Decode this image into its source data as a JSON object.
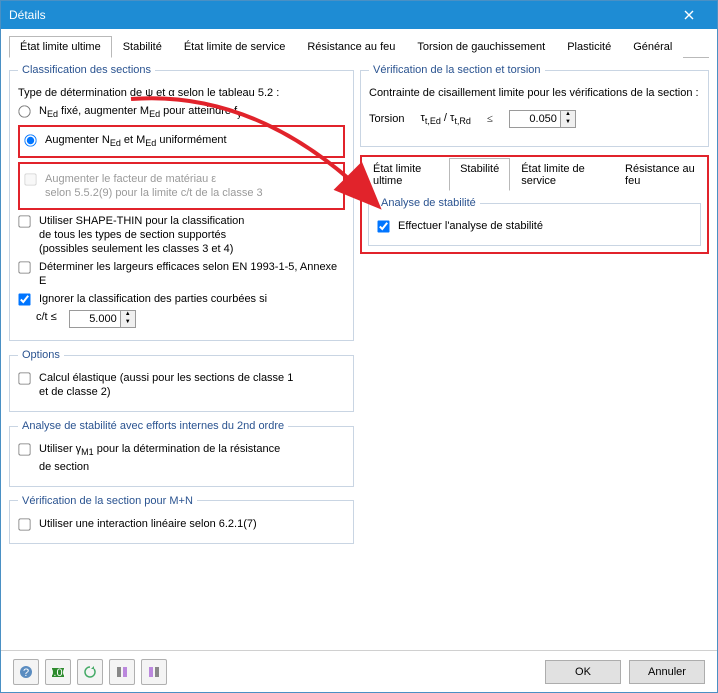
{
  "window": {
    "title": "Détails"
  },
  "tabs": {
    "t1": "État limite ultime",
    "t2": "Stabilité",
    "t3": "État limite de service",
    "t4": "Résistance au feu",
    "t5": "Torsion de gauchissement",
    "t6": "Plasticité",
    "t7": "Général"
  },
  "classif": {
    "legend": "Classification des sections",
    "intro": "Type de détermination de ψ et α selon le tableau 5.2 :",
    "r1a": "N",
    "r1b": " fixé, augmenter M",
    "r1c": " pour atteindre f",
    "r2a": "Augmenter  N",
    "r2b": " et M",
    "r2c": " uniformément",
    "factorA": "Augmenter le facteur de matériau ε",
    "factorB": "selon 5.5.2(9) pour la limite c/t de la classe 3",
    "shapeA": "Utiliser SHAPE-THIN pour la classification",
    "shapeB": "de tous les types de section supportés",
    "shapeC": "(possibles seulement les classes 3 et 4)",
    "widths": "Déterminer les largeurs efficaces selon EN 1993-1-5, Annexe E",
    "ignore": "Ignorer la classification des parties courbées si",
    "ctlabel": "c/t ≤",
    "ctval": "5.000"
  },
  "options": {
    "legend": "Options",
    "elasticA": "Calcul élastique (aussi pour les sections de classe 1",
    "elasticB": "et de classe 2)"
  },
  "stab2": {
    "legend": "Analyse de stabilité avec efforts internes du 2nd ordre",
    "gmA": "Utiliser γ",
    "gmSub": "M1",
    "gmB": " pour la détermination de la résistance",
    "gmC": "de section"
  },
  "mn": {
    "legend": "Vérification de la section pour M+N",
    "lin": "Utiliser une interaction linéaire selon 6.2.1(7)"
  },
  "verif": {
    "legend": "Vérification de la section et torsion",
    "shear": "Contrainte de cisaillement limite pour les vérifications de la section :",
    "torsion": "Torsion",
    "ratioA": "τ",
    "ratioSub1": "t,Ed",
    "ratioMid": " / τ",
    "ratioSub2": "t,Rd",
    "le": "≤",
    "val": "0.050"
  },
  "tabs2": {
    "t1": "État limite ultime",
    "t2": "Stabilité",
    "t3": "État limite de service",
    "t4": "Résistance au feu"
  },
  "stabpanel": {
    "legend": "Analyse de stabilité",
    "do": "Effectuer l'analyse de stabilité"
  },
  "footer": {
    "ok": "OK",
    "cancel": "Annuler"
  }
}
